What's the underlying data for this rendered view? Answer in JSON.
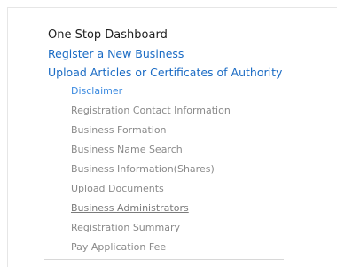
{
  "nav": {
    "dashboard_label": "One Stop Dashboard",
    "register_label": "Register a New Business",
    "upload_label": "Upload Articles or Certificates of Authority",
    "steps": [
      {
        "label": "Disclaimer"
      },
      {
        "label": "Registration Contact Information"
      },
      {
        "label": "Business Formation"
      },
      {
        "label": "Business Name Search"
      },
      {
        "label": "Business Information(Shares)"
      },
      {
        "label": "Upload Documents"
      },
      {
        "label": "Business Administrators"
      },
      {
        "label": "Registration Summary"
      },
      {
        "label": "Pay Application Fee"
      }
    ]
  },
  "colors": {
    "link": "#1a6bc4",
    "current_step": "#3d8be0",
    "inactive_step": "#8a8a8a",
    "heading": "#1f1f1f"
  }
}
